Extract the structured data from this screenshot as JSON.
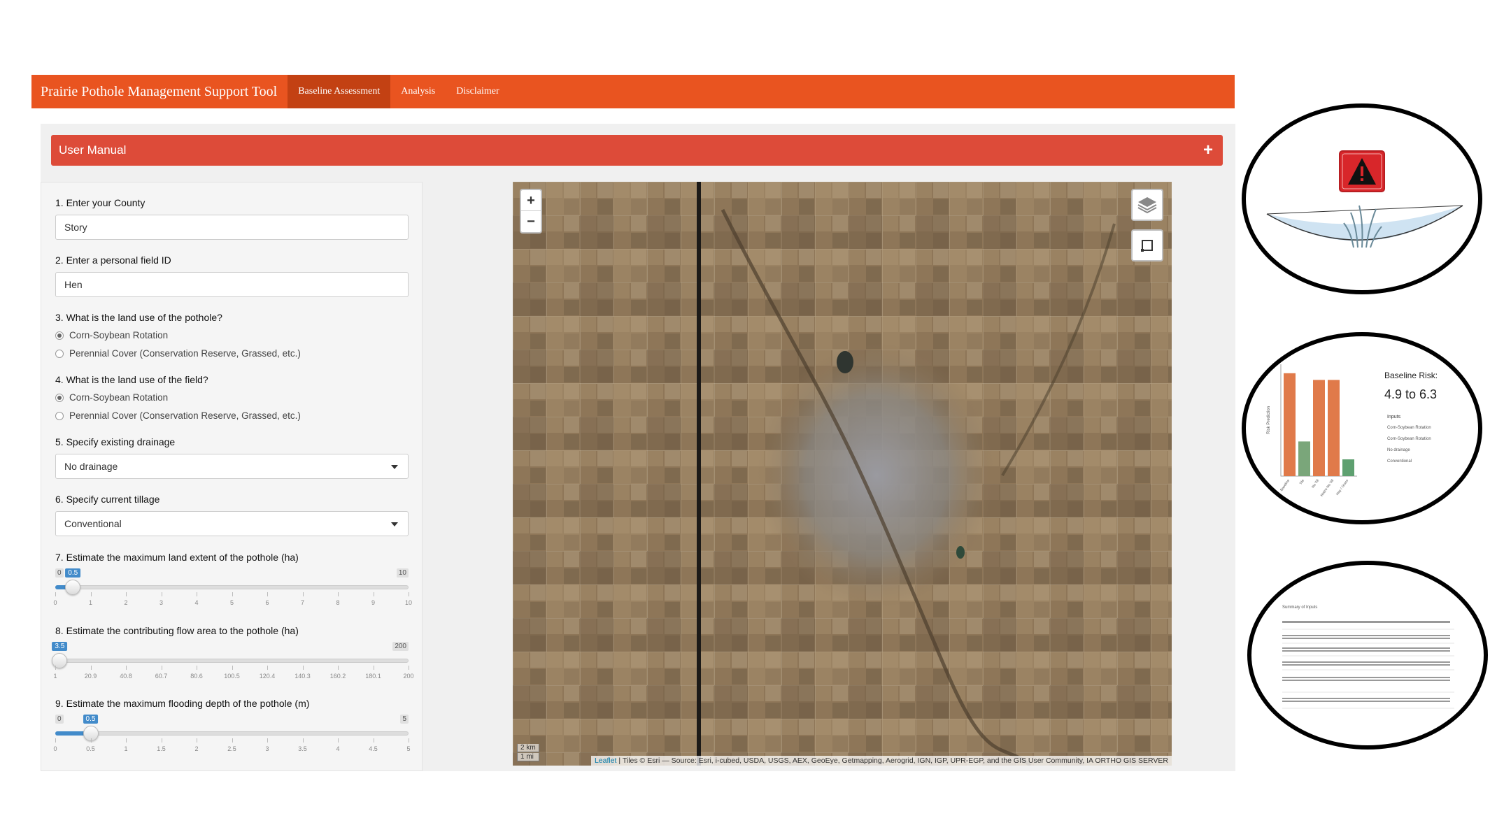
{
  "navbar": {
    "brand": "Prairie Pothole Management Support Tool",
    "tabs": [
      "Baseline Assessment",
      "Analysis",
      "Disclaimer"
    ],
    "active_tab": "Baseline Assessment",
    "color": "#e95420",
    "active_color": "#c34113"
  },
  "manual": {
    "title": "User Manual",
    "toggle": "+"
  },
  "form": {
    "q1": {
      "label": "1. Enter your County",
      "value": "Story"
    },
    "q2": {
      "label": "2. Enter a personal field ID",
      "value": "Hen"
    },
    "q3": {
      "label": "3. What is the land use of the pothole?",
      "options": [
        "Corn-Soybean Rotation",
        "Perennial Cover (Conservation Reserve, Grassed, etc.)"
      ],
      "selected": 0
    },
    "q4": {
      "label": "4. What is the land use of the field?",
      "options": [
        "Corn-Soybean Rotation",
        "Perennial Cover (Conservation Reserve, Grassed, etc.)"
      ],
      "selected": 0
    },
    "q5": {
      "label": "5. Specify existing drainage",
      "value": "No drainage"
    },
    "q6": {
      "label": "6. Specify current tillage",
      "value": "Conventional"
    },
    "q7": {
      "label": "7. Estimate the maximum land extent of the pothole (ha)",
      "min": "0",
      "max": "10",
      "value": "0.5",
      "fraction": 0.05,
      "ticks": [
        "0",
        "1",
        "2",
        "3",
        "4",
        "5",
        "6",
        "7",
        "8",
        "9",
        "10"
      ]
    },
    "q8": {
      "label": "8. Estimate the contributing flow area to the pothole (ha)",
      "min": "1",
      "max": "200",
      "value": "3.5",
      "fraction": 0.0126,
      "ticks": [
        "1",
        "20.9",
        "40.8",
        "60.7",
        "80.6",
        "100.5",
        "120.4",
        "140.3",
        "160.2",
        "180.1",
        "200"
      ]
    },
    "q9": {
      "label": "9. Estimate the maximum flooding depth of the pothole (m)",
      "min": "0",
      "max": "5",
      "value": "0.5",
      "fraction": 0.1,
      "ticks": [
        "0",
        "0.5",
        "1",
        "1.5",
        "2",
        "2.5",
        "3",
        "3.5",
        "4",
        "4.5",
        "5"
      ]
    }
  },
  "map": {
    "zoom_in": "+",
    "zoom_out": "−",
    "scale_km": "2 km",
    "scale_mi": "1 mi",
    "attribution_link": "Leaflet",
    "attribution": " | Tiles © Esri — Source: Esri, i-cubed, USDA, USGS, AEX, GeoEye, Getmapping, Aerogrid, IGN, IGP, UPR-EGP, and the GIS User Community, IA ORTHO GIS SERVER"
  },
  "callouts": {
    "risk_title": "Baseline Risk:",
    "risk_value": "4.9 to 6.3",
    "chart_ylabel": "Risk Prediction",
    "inputs_title": "Inputs",
    "inputs": [
      "Corn-Soybean Rotation",
      "Corn-Soybean Rotation",
      "No drainage",
      "Conventional"
    ],
    "summary_title": "Summary of Inputs"
  },
  "chart_data": {
    "type": "bar",
    "categories": [
      "Baseline",
      "Tile",
      "No Till",
      "Retire No Till",
      "Hay / Grass"
    ],
    "values": [
      9.2,
      3.1,
      8.6,
      8.6,
      1.5
    ],
    "colors": [
      "#e07a4a",
      "#7aa67a",
      "#e07a4a",
      "#e07a4a",
      "#5ea070"
    ]
  }
}
